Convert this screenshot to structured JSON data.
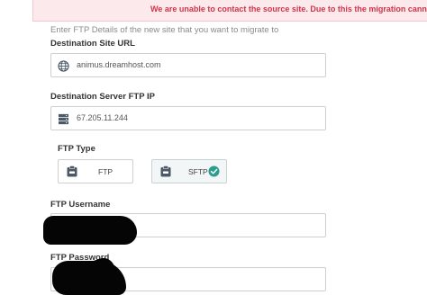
{
  "error": {
    "message": "We are unable to contact the source site. Due to this the migration cannot be comp"
  },
  "intro_text": "Enter FTP Details of the new site that you want to migrate to",
  "destination_url": {
    "label": "Destination Site URL",
    "value": "animus.dreamhost.com",
    "icon": "globe-icon"
  },
  "ftp_ip": {
    "label": "Destination Server FTP IP",
    "value": "67.205.11.244",
    "icon": "server-icon"
  },
  "ftp_type": {
    "label": "FTP Type",
    "options": [
      {
        "label": "FTP",
        "selected": false,
        "icon": "clipboard-icon"
      },
      {
        "label": "SFTP",
        "selected": true,
        "icon": "clipboard-icon"
      }
    ],
    "selected_icon": "check-circle-icon"
  },
  "ftp_username": {
    "label": "FTP Username",
    "value": ""
  },
  "ftp_password": {
    "label": "FTP Password",
    "value": ""
  },
  "colors": {
    "error_bg": "#fce9ec",
    "error_text": "#d0344a",
    "check": "#2a9d8f",
    "icon": "#4b5866"
  }
}
